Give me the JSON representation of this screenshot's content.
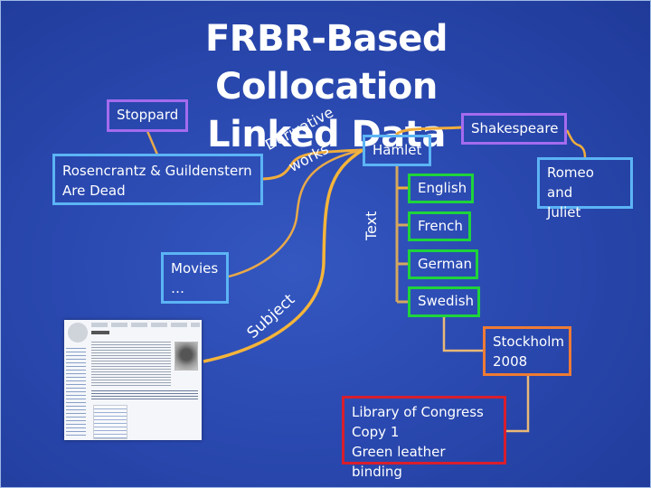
{
  "slide": {
    "title_line1": "FRBR-Based Collocation",
    "title_line2": "Linked Data",
    "background_color": "#2a49b0"
  },
  "nodes": {
    "stoppard": {
      "label": "Stoppard",
      "type": "author",
      "border_color": "#a46bef"
    },
    "shakespeare": {
      "label": "Shakespeare",
      "type": "author",
      "border_color": "#a46bef"
    },
    "rosencrantz": {
      "label": "Rosencrantz & Guildenstern\nAre Dead",
      "type": "work",
      "border_color": "#5cb4f5"
    },
    "hamlet": {
      "label": "Hamlet",
      "type": "work",
      "border_color": "#5cb4f5"
    },
    "romeo": {
      "label": "Romeo and\nJuliet",
      "type": "work",
      "border_color": "#5cb4f5"
    },
    "movies": {
      "label": "Movies\n…",
      "type": "work",
      "border_color": "#5cb4f5"
    },
    "english": {
      "label": "English",
      "type": "expression",
      "border_color": "#1ed43a"
    },
    "french": {
      "label": "French",
      "type": "expression",
      "border_color": "#1ed43a"
    },
    "german": {
      "label": "German",
      "type": "expression",
      "border_color": "#1ed43a"
    },
    "swedish": {
      "label": "Swedish",
      "type": "expression",
      "border_color": "#1ed43a"
    },
    "stockholm": {
      "label": "Stockholm\n2008",
      "type": "manifestation",
      "border_color": "#ee7b35"
    },
    "loc": {
      "label": "Library of Congress\nCopy 1\nGreen leather binding",
      "type": "item",
      "border_color": "#d81e2d"
    }
  },
  "edge_labels": {
    "derivative": "Derivative",
    "works": "works",
    "text": "Text",
    "subject": "Subject"
  },
  "links_color": "#f0ad3c",
  "thumbnail": {
    "description": "Wikipedia article screenshot: Hamlet",
    "icon": "wikipedia-page-thumbnail"
  }
}
